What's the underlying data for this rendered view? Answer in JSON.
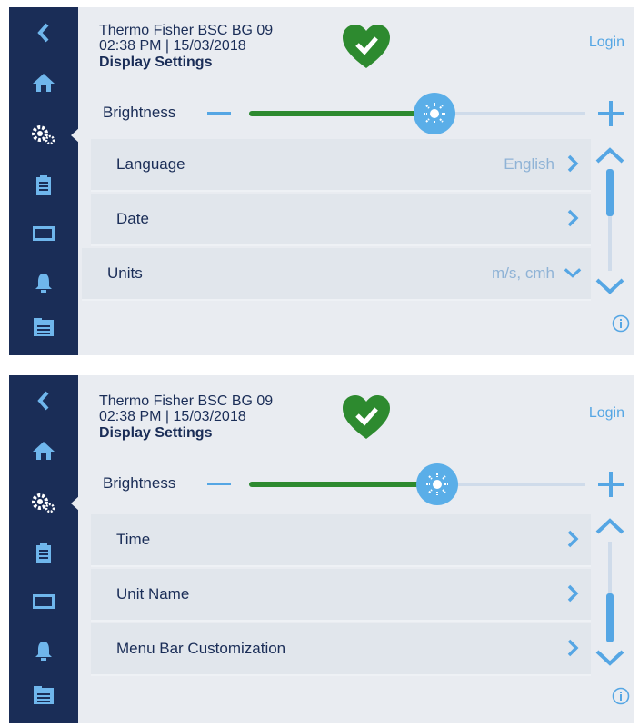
{
  "screens": [
    {
      "header": {
        "device": "Thermo Fisher BSC BG 09",
        "datetime": "02:38 PM | 15/03/2018",
        "page": "Display Settings",
        "login": "Login"
      },
      "brightness": {
        "label": "Brightness",
        "level": 0.55
      },
      "rows": [
        {
          "label": "Language",
          "value": "English",
          "arrow": "chevron-right"
        },
        {
          "label": "Date",
          "value": "",
          "arrow": "chevron-right"
        },
        {
          "label": "Units",
          "value": "m/s, cmh",
          "arrow": "chevron-down"
        }
      ],
      "scroll": {
        "position": "top"
      }
    },
    {
      "header": {
        "device": "Thermo Fisher BSC BG 09",
        "datetime": "02:38 PM | 15/03/2018",
        "page": "Display Settings",
        "login": "Login"
      },
      "brightness": {
        "label": "Brightness",
        "level": 0.56
      },
      "rows": [
        {
          "label": "Time",
          "value": "",
          "arrow": "chevron-right"
        },
        {
          "label": "Unit Name",
          "value": "",
          "arrow": "chevron-right"
        },
        {
          "label": "Menu Bar Customization",
          "value": "",
          "arrow": "chevron-right"
        }
      ],
      "scroll": {
        "position": "bottom"
      }
    }
  ],
  "sidebar": {
    "items": [
      "back-icon",
      "home-icon",
      "settings-icon",
      "clipboard-icon",
      "display-icon",
      "bell-icon",
      "folder-icon"
    ],
    "active": "settings-icon"
  },
  "colors": {
    "sidebar": "#1a2d57",
    "accent": "#55a6e4",
    "brightness_fill": "#2d8a2f",
    "heart": "#2d8a2f"
  }
}
